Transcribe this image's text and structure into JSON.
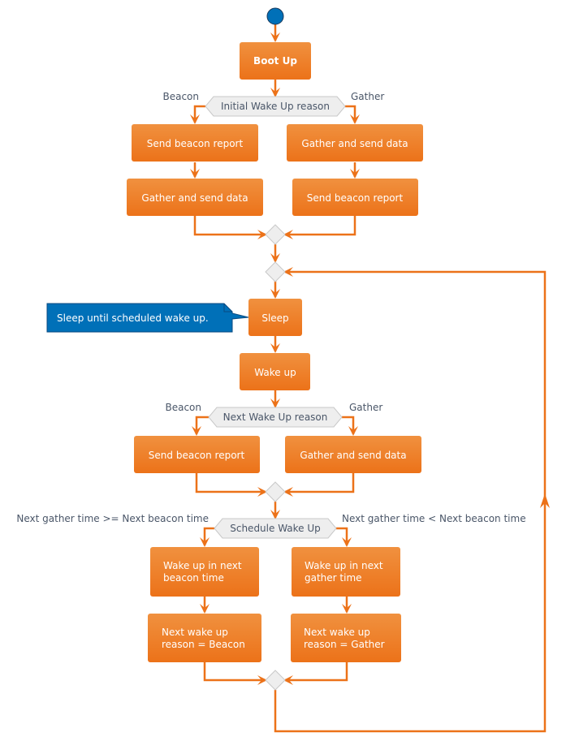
{
  "diagram": {
    "type": "activity",
    "colors": {
      "activity_fill_top": "#f0913f",
      "activity_fill_bottom": "#ec7219",
      "edge": "#ec7219",
      "decision_fill": "#eeeeee",
      "decision_stroke": "#c8c8c8",
      "start_node": "#0070b8",
      "note_fill": "#0070b8",
      "label_text": "#4a5668"
    },
    "start": {
      "label": "start"
    },
    "boot": {
      "label": "Boot Up"
    },
    "initial_decision": {
      "label": "Initial Wake Up reason",
      "left_guard": "Beacon",
      "right_guard": "Gather",
      "left_branch": [
        "Send beacon report",
        "Gather and send data"
      ],
      "right_branch": [
        "Gather and send data",
        "Send beacon report"
      ]
    },
    "loop": {
      "sleep": "Sleep",
      "note": "Sleep until scheduled wake up.",
      "wake": "Wake up"
    },
    "next_decision": {
      "label": "Next Wake Up reason",
      "left_guard": "Beacon",
      "right_guard": "Gather",
      "left_branch": [
        "Send beacon report"
      ],
      "right_branch": [
        "Gather and send data"
      ]
    },
    "schedule_decision": {
      "label": "Schedule Wake Up",
      "left_guard": "Next gather time >= Next beacon time",
      "right_guard": "Next gather time < Next beacon time",
      "left_branch": [
        [
          "Wake up in next",
          "beacon time"
        ],
        [
          "Next wake up",
          "reason = Beacon"
        ]
      ],
      "right_branch": [
        [
          "Wake up in next",
          "gather time"
        ],
        [
          "Next wake up",
          "reason = Gather"
        ]
      ]
    }
  }
}
